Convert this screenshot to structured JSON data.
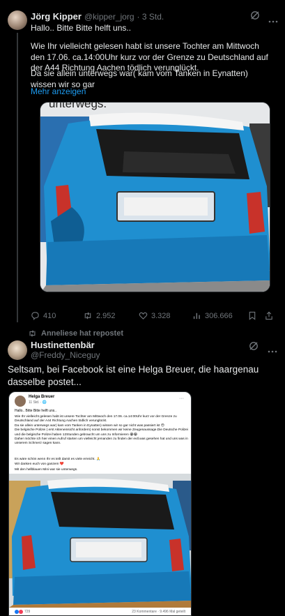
{
  "tweet1": {
    "author": "Jörg Kipper",
    "handle": "@kipper_jorg",
    "time": "· 3 Std.",
    "first_line": "Hallo.. Bitte Bitte helft uns..",
    "paragraph": "Wie Ihr vielleicht gelesen habt ist unsere Tochter am Mittwoch den 17.06. ca.14:00Uhr kurz vor der Grenze zu Deutschland auf der A44 Richtung Aachen tödlich verunglückt.",
    "paragraph2": "Da sie allein unterwegs war( kam vom Tanken in Eynatten) wissen wir so gar",
    "show_more": "Mehr anzeigen",
    "image_caption_fragment": "unterwegs.",
    "stats": {
      "replies": "410",
      "retweets": "2.952",
      "likes": "3.328",
      "views": "306.666"
    }
  },
  "repost_label": "Anneliese hat repostet",
  "tweet2": {
    "author": "Hustinettenbär",
    "handle": "@Freddy_Niceguy",
    "text": "Seltsam, bei Facebook ist eine Helga Breuer, die haargenau dasselbe postet...",
    "fb_screenshot": {
      "name": "Helga Breuer",
      "time": "11 Std. · 🌐",
      "line1": "Hallo.. Bitte Bitte helft uns..",
      "body": "Wie Ihr vielleicht gelesen habt ist unsere Tochter am Mittwoch den 17.06. ca.14:00Uhr kurz vor der Grenze zu Deutschland auf der A44 Richtung Aachen tödlich verunglückt.\nDa sie allein unterwegs war( kam vom Tanken in Eynatten) wissen wir so gar nicht was passiert ist 😔\nDie belgische Polizei ( erst Akteneinsicht anfordern) sonst bekommen wir keine Zeugenaussage.Die Deutsche Polizei und die belgische Polizei haben 12Stunden gebraucht um uns zu Informieren 😭😭\nDaher möchte ich hier einen Aufruf starten um vielleicht jemanden zu finden der evtl.was gesehen hat und uns was in unserem Schmerz sagen kann.",
      "line_b": "Es wäre schön wenn Ihr es teilt damit es viele erreicht. 🙏",
      "line_c": "Wir danken euch von ganzem ❤️",
      "line_d": "Mit den hellblauen Mini war sie unterwegs.",
      "reactions": "729",
      "comments": "23 Kommentare · 9.496 Mal geteilt"
    }
  },
  "colors": {
    "accent": "#1d9bf0",
    "car_blue": "#1f8fd0",
    "background": "#000000"
  }
}
